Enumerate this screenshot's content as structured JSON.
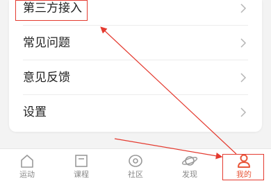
{
  "menu": {
    "items": [
      {
        "label": "第三方接入"
      },
      {
        "label": "常见问题"
      },
      {
        "label": "意见反馈"
      },
      {
        "label": "设置"
      }
    ]
  },
  "tabbar": {
    "tabs": [
      {
        "label": "运动",
        "icon": "home-icon"
      },
      {
        "label": "课程",
        "icon": "course-icon"
      },
      {
        "label": "社区",
        "icon": "eye-icon"
      },
      {
        "label": "发现",
        "icon": "planet-icon"
      },
      {
        "label": "我的",
        "icon": "user-icon",
        "active": true
      }
    ]
  },
  "colors": {
    "accent": "#e8573a",
    "annotation": "#e43a2f"
  }
}
